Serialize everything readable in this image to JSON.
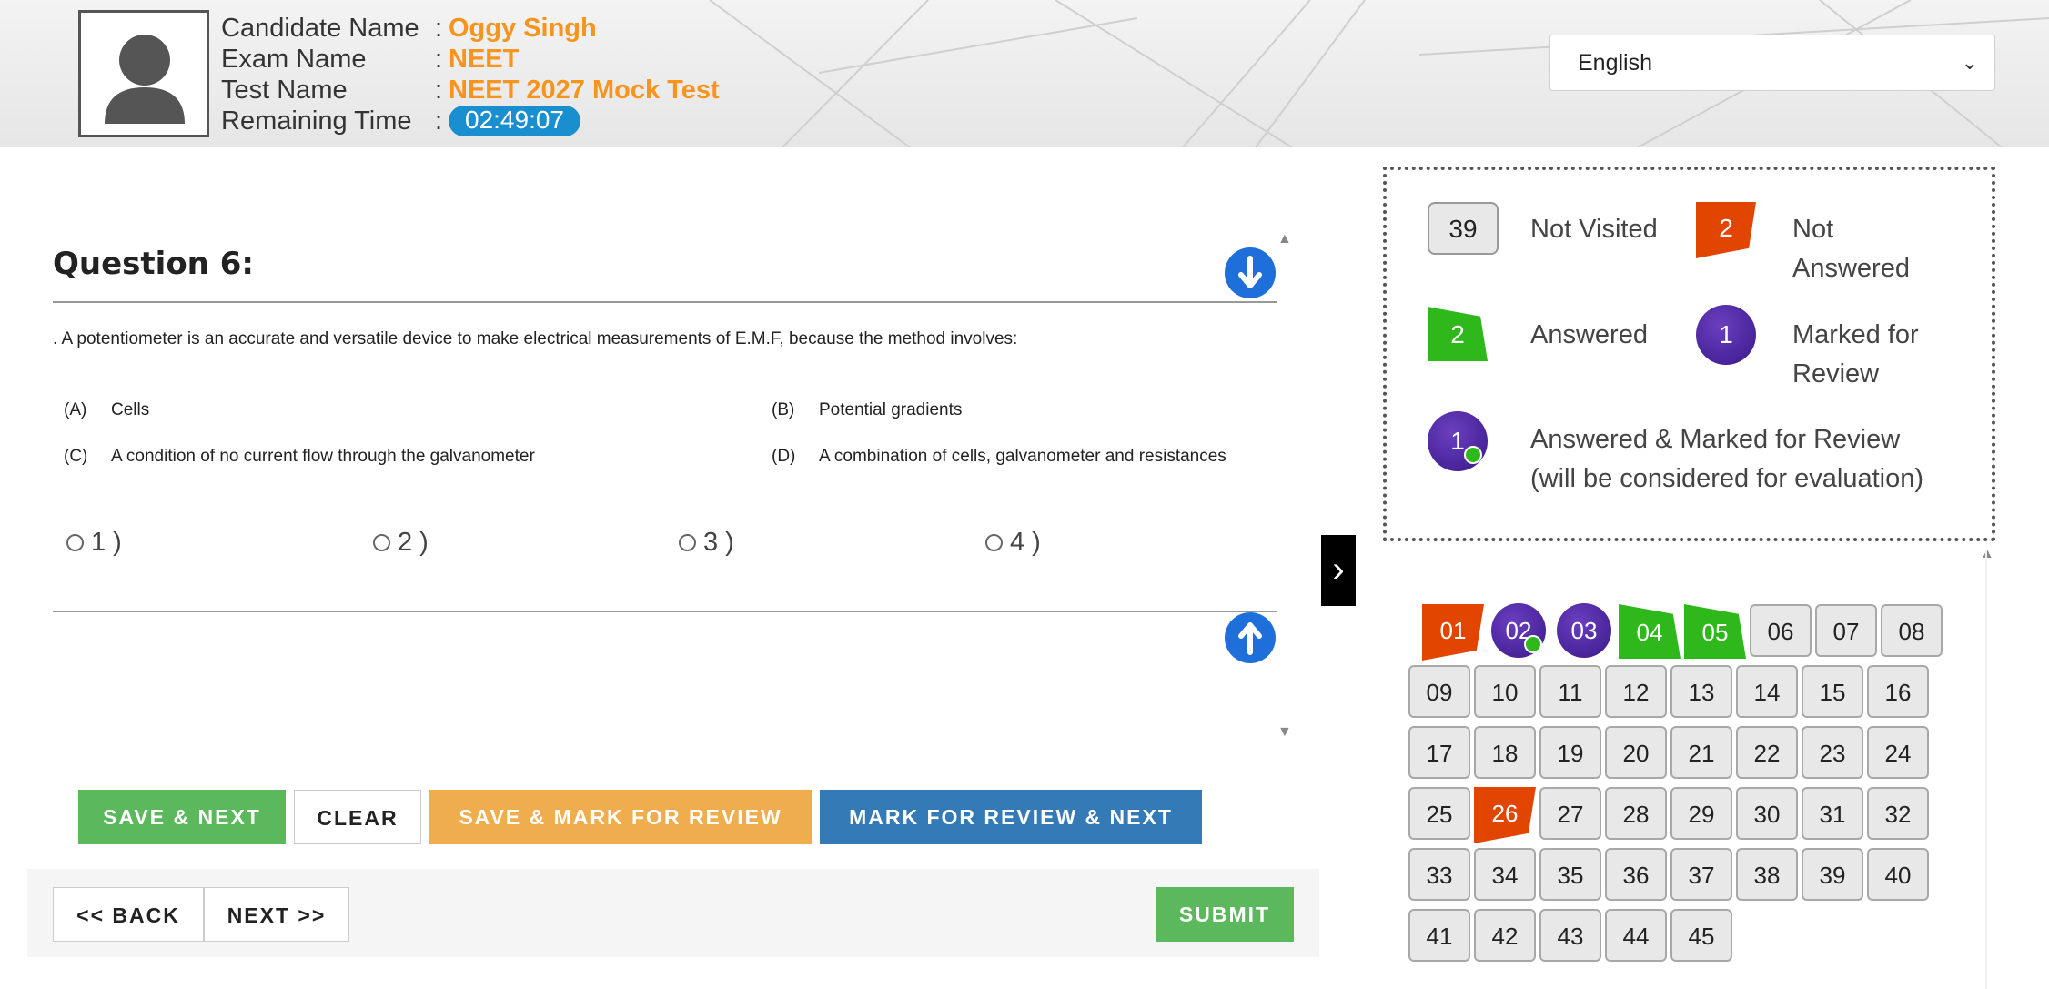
{
  "header": {
    "candidate_label": "Candidate Name",
    "candidate_value": "Oggy Singh",
    "exam_label": "Exam Name",
    "exam_value": "NEET",
    "test_label": "Test Name",
    "test_value": "NEET 2027 Mock Test",
    "time_label": "Remaining Time",
    "time_value": "02:49:07",
    "colon": ":",
    "language": "English"
  },
  "question": {
    "title": "Question 6:",
    "text": ". A potentiometer is an accurate and versatile device to make electrical measurements of E.M.F, because the method involves:",
    "options": [
      {
        "key": "(A)",
        "text": "Cells"
      },
      {
        "key": "(B)",
        "text": "Potential gradients"
      },
      {
        "key": "(C)",
        "text": "A condition of no current flow through the galvanometer"
      },
      {
        "key": "(D)",
        "text": "A combination of cells, galvanometer and resistances"
      }
    ],
    "choices": [
      "1 )",
      "2 )",
      "3 )",
      "4 )"
    ]
  },
  "actions": {
    "save_next": "SAVE & NEXT",
    "clear": "CLEAR",
    "save_mark": "SAVE & MARK FOR REVIEW",
    "mark_next": "MARK FOR REVIEW & NEXT",
    "back": "<< BACK",
    "next": "NEXT >>",
    "submit": "SUBMIT"
  },
  "legend": {
    "not_visited_count": "39",
    "not_visited_label": "Not Visited",
    "not_answered_count": "2",
    "not_answered_label_1": "Not",
    "not_answered_label_2": "Answered",
    "answered_count": "2",
    "answered_label": "Answered",
    "marked_count": "1",
    "marked_label_1": "Marked for",
    "marked_label_2": "Review",
    "ans_marked_count": "1",
    "ans_marked_label_1": "Answered & Marked for Review",
    "ans_marked_label_2": "(will be considered for evaluation)"
  },
  "palette": [
    {
      "n": "01",
      "s": "na"
    },
    {
      "n": "02",
      "s": "am"
    },
    {
      "n": "03",
      "s": "mk"
    },
    {
      "n": "04",
      "s": "ans"
    },
    {
      "n": "05",
      "s": "ans"
    },
    {
      "n": "06",
      "s": "nv"
    },
    {
      "n": "07",
      "s": "nv"
    },
    {
      "n": "08",
      "s": "nv"
    },
    {
      "n": "09",
      "s": "nv"
    },
    {
      "n": "10",
      "s": "nv"
    },
    {
      "n": "11",
      "s": "nv"
    },
    {
      "n": "12",
      "s": "nv"
    },
    {
      "n": "13",
      "s": "nv"
    },
    {
      "n": "14",
      "s": "nv"
    },
    {
      "n": "15",
      "s": "nv"
    },
    {
      "n": "16",
      "s": "nv"
    },
    {
      "n": "17",
      "s": "nv"
    },
    {
      "n": "18",
      "s": "nv"
    },
    {
      "n": "19",
      "s": "nv"
    },
    {
      "n": "20",
      "s": "nv"
    },
    {
      "n": "21",
      "s": "nv"
    },
    {
      "n": "22",
      "s": "nv"
    },
    {
      "n": "23",
      "s": "nv"
    },
    {
      "n": "24",
      "s": "nv"
    },
    {
      "n": "25",
      "s": "nv"
    },
    {
      "n": "26",
      "s": "na"
    },
    {
      "n": "27",
      "s": "nv"
    },
    {
      "n": "28",
      "s": "nv"
    },
    {
      "n": "29",
      "s": "nv"
    },
    {
      "n": "30",
      "s": "nv"
    },
    {
      "n": "31",
      "s": "nv"
    },
    {
      "n": "32",
      "s": "nv"
    },
    {
      "n": "33",
      "s": "nv"
    },
    {
      "n": "34",
      "s": "nv"
    },
    {
      "n": "35",
      "s": "nv"
    },
    {
      "n": "36",
      "s": "nv"
    },
    {
      "n": "37",
      "s": "nv"
    },
    {
      "n": "38",
      "s": "nv"
    },
    {
      "n": "39",
      "s": "nv"
    },
    {
      "n": "40",
      "s": "nv"
    },
    {
      "n": "41",
      "s": "nv"
    },
    {
      "n": "42",
      "s": "nv"
    },
    {
      "n": "43",
      "s": "nv"
    },
    {
      "n": "44",
      "s": "nv"
    },
    {
      "n": "45",
      "s": "nv"
    }
  ],
  "colors": {
    "accent_orange": "#f7941d",
    "timer_blue": "#1a8fd0",
    "not_answered": "#e14500",
    "answered": "#2fb81c",
    "marked": "#4a22a0",
    "save_next": "#5cb85c",
    "save_mark": "#f0ad4e",
    "mark_next": "#337ab7"
  }
}
